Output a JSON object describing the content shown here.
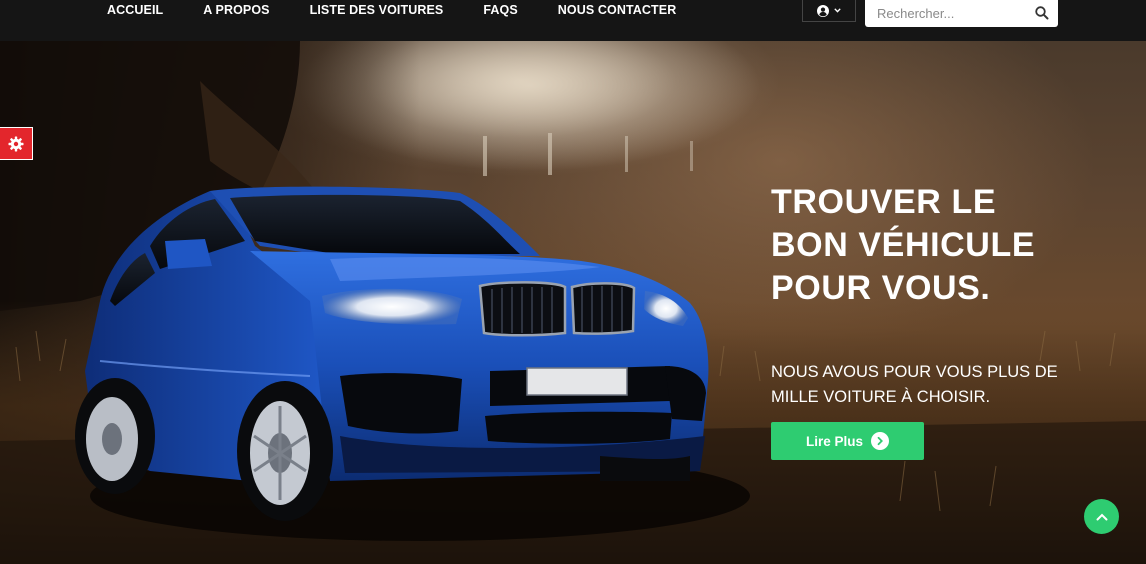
{
  "nav": {
    "items": [
      {
        "label": "ACCUEIL"
      },
      {
        "label": "A PROPOS"
      },
      {
        "label": "LISTE DES VOITURES"
      },
      {
        "label": "FAQS"
      },
      {
        "label": "NOUS CONTACTER"
      }
    ]
  },
  "user_menu": {
    "icon": "user-circle-icon",
    "caret_icon": "chevron-down-icon"
  },
  "search": {
    "placeholder": "Rechercher...",
    "value": "",
    "icon": "search-icon"
  },
  "settings": {
    "icon": "gear-icon",
    "color": "#e3262c"
  },
  "hero": {
    "title": "TROUVER LE BON VÉHICULE POUR VOUS.",
    "subtitle": "NOUS AVOUS POUR VOUS PLUS DE MILLE VOITURE À CHOISIR.",
    "cta_label": "Lire Plus",
    "cta_icon": "chevron-right-circle-icon",
    "accent_color": "#2ecc71"
  },
  "back_to_top": {
    "icon": "chevron-up-icon"
  }
}
